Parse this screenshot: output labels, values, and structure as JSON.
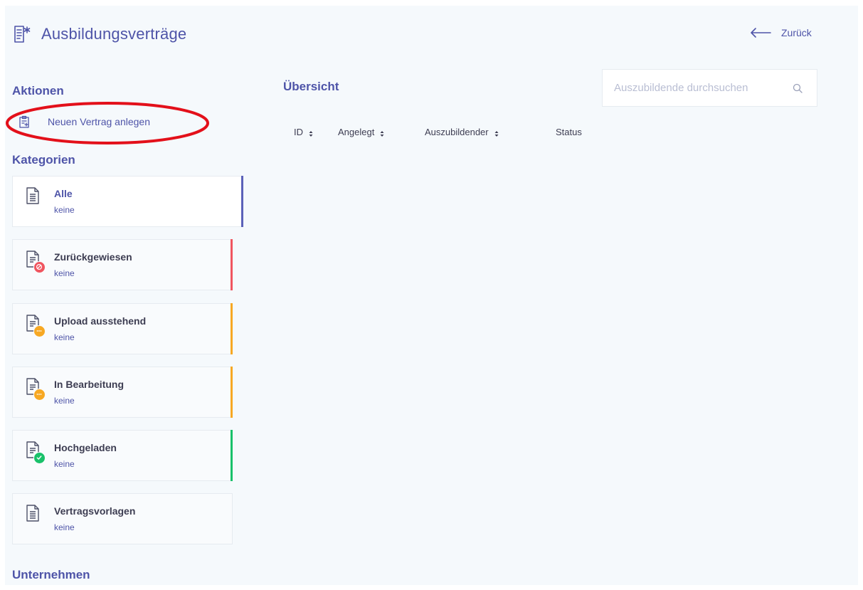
{
  "header": {
    "title": "Ausbildungsverträge",
    "title_icon": "document-edit-icon",
    "back_label": "Zurück",
    "back_icon": "arrow-left-icon"
  },
  "sidebar": {
    "actions_heading": "Aktionen",
    "actions": [
      {
        "label": "Neuen Vertrag anlegen",
        "icon": "clipboard-add-icon"
      }
    ],
    "categories_heading": "Kategorien",
    "categories": [
      {
        "name": "Alle",
        "count": "keine",
        "status_color": "#5b62b9",
        "badge": null,
        "active": true
      },
      {
        "name": "Zurückgewiesen",
        "count": "keine",
        "status_color": "#f0555f",
        "badge": "rejected-badge-icon"
      },
      {
        "name": "Upload ausstehend",
        "count": "keine",
        "status_color": "#f7a823",
        "badge": "pending-badge-icon"
      },
      {
        "name": "In Bearbeitung",
        "count": "keine",
        "status_color": "#f7a823",
        "badge": "pending-badge-icon"
      },
      {
        "name": "Hochgeladen",
        "count": "keine",
        "status_color": "#19c16a",
        "badge": "check-badge-icon"
      },
      {
        "name": "Vertragsvorlagen",
        "count": "keine",
        "status_color": null,
        "badge": null
      }
    ],
    "company_heading": "Unternehmen"
  },
  "main": {
    "title": "Übersicht",
    "search": {
      "placeholder": "Auszubildende durchsuchen",
      "value": ""
    },
    "columns": [
      {
        "label": "ID",
        "sortable": true
      },
      {
        "label": "Angelegt",
        "sortable": true
      },
      {
        "label": "Auszubildender",
        "sortable": true
      },
      {
        "label": "Status",
        "sortable": false
      }
    ],
    "rows": []
  },
  "colors": {
    "accent": "#4e54a8",
    "background": "#f5f9fc",
    "annotation": "#e3101a"
  }
}
